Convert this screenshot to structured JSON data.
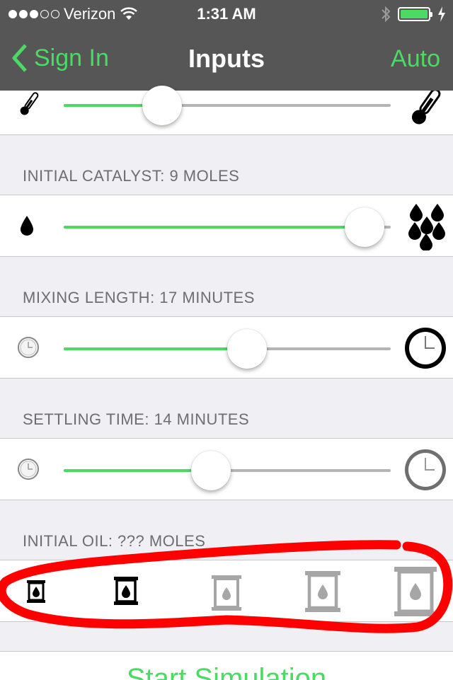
{
  "status_bar": {
    "carrier": "Verizon",
    "time": "1:31 AM"
  },
  "nav": {
    "back_label": "Sign In",
    "title": "Inputs",
    "right_label": "Auto"
  },
  "sliders": [
    {
      "label": "",
      "min_icon": "small-thermometer-icon",
      "max_icon": "large-thermometer-icon",
      "value": 0.3
    },
    {
      "label": "INITIAL CATALYST: 9 MOLES",
      "min_icon": "single-drop-icon",
      "max_icon": "many-drops-icon",
      "value": 0.92
    },
    {
      "label": "MIXING LENGTH: 17 MINUTES",
      "min_icon": "small-clock-icon",
      "max_icon": "large-clock-icon",
      "value": 0.56
    },
    {
      "label": "SETTLING TIME: 14 MINUTES",
      "min_icon": "small-clock-icon",
      "max_icon": "large-clock-icon",
      "value": 0.45
    }
  ],
  "oil": {
    "label": "INITIAL OIL: ??? MOLES",
    "options": [
      {
        "icon": "barrel-icon-1",
        "state": "active"
      },
      {
        "icon": "barrel-icon-2",
        "state": "active"
      },
      {
        "icon": "barrel-icon-3",
        "state": "inactive"
      },
      {
        "icon": "barrel-icon-4",
        "state": "inactive"
      },
      {
        "icon": "barrel-icon-5",
        "state": "inactive"
      }
    ],
    "highlight_color": "#ff0000"
  },
  "start_button": {
    "label": "Start Simulation"
  },
  "colors": {
    "accent": "#4cd964",
    "nav_bg": "#565656",
    "inactive_icon": "#a6a6a6"
  }
}
